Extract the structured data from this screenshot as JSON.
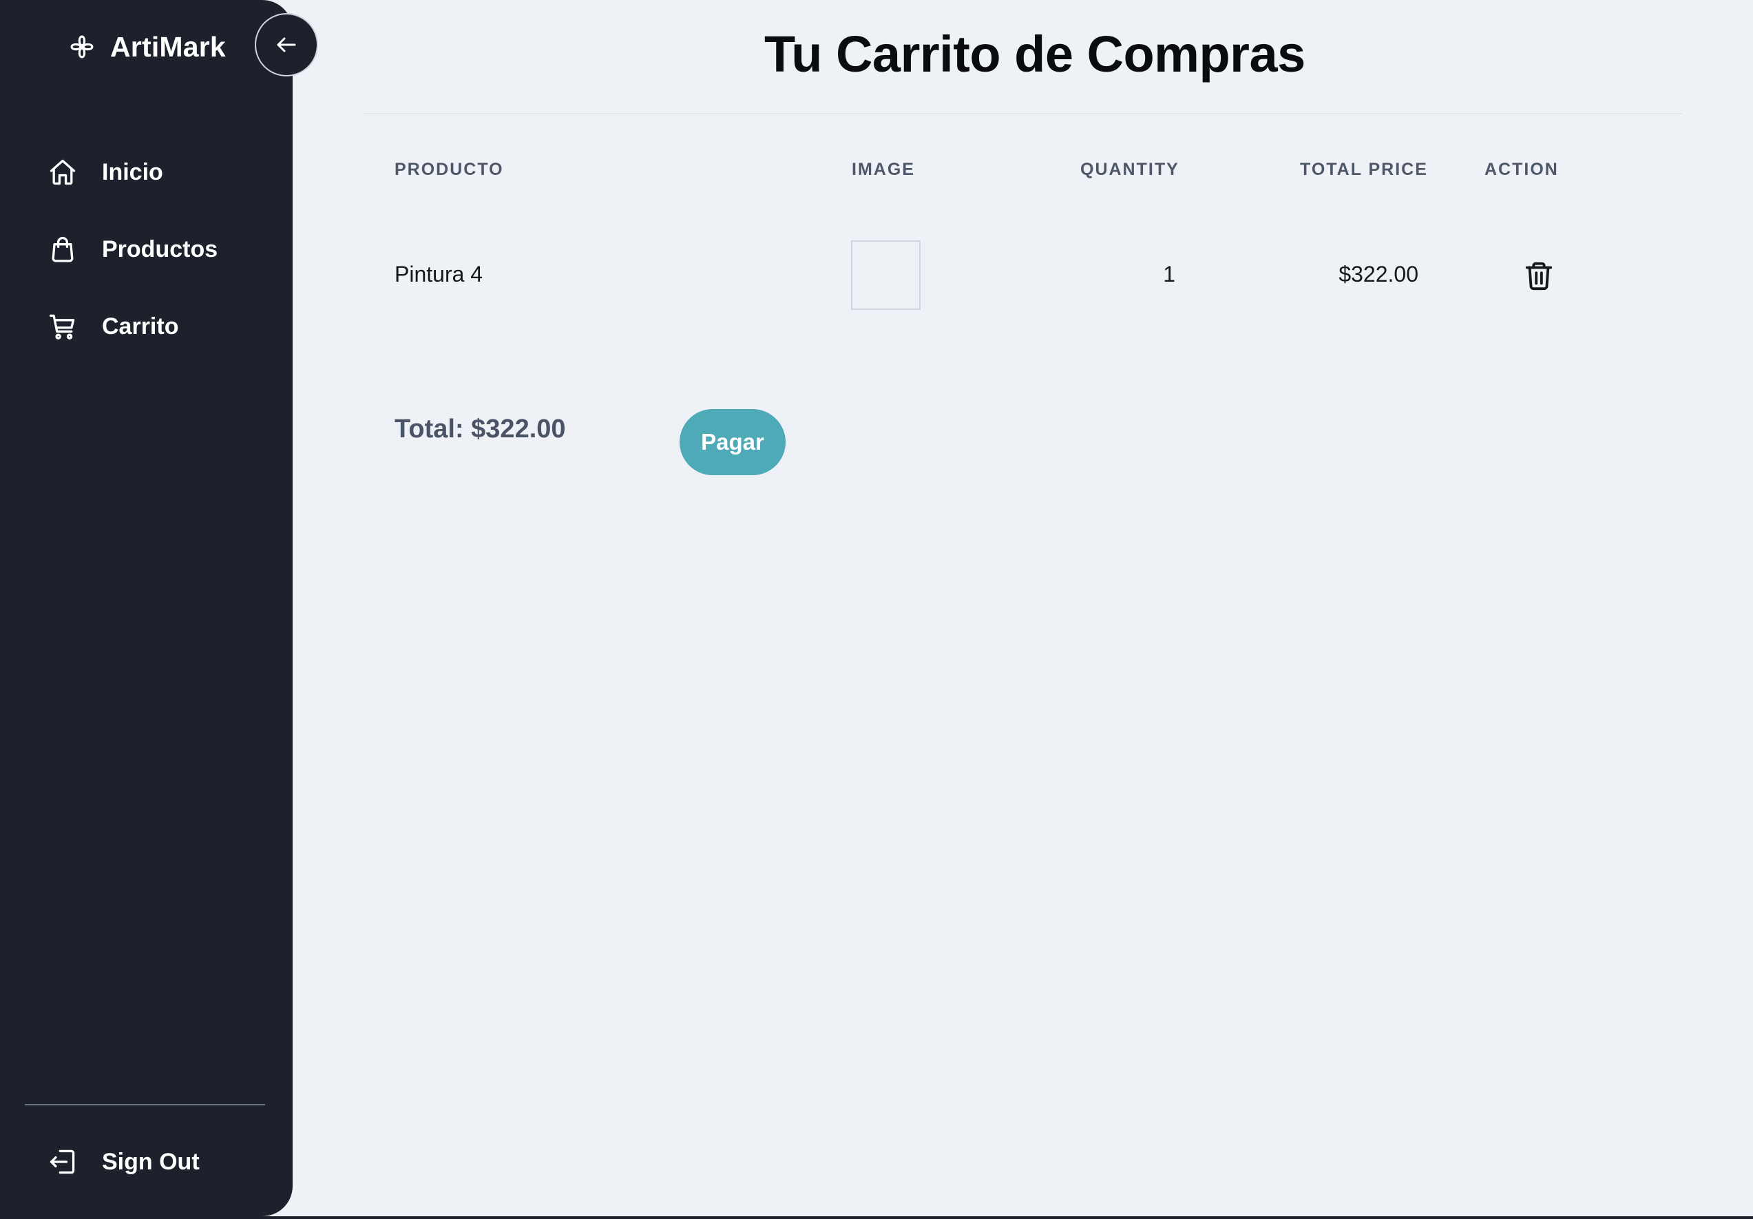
{
  "sidebar": {
    "brand": "ArtiMark",
    "nav_items": [
      {
        "label": "Inicio",
        "icon": "home-icon"
      },
      {
        "label": "Productos",
        "icon": "shopping-bag-icon"
      },
      {
        "label": "Carrito",
        "icon": "cart-icon"
      }
    ],
    "sign_out": {
      "label": "Sign Out",
      "icon": "sign-out-icon"
    },
    "collapse_icon": "arrow-left-icon"
  },
  "main": {
    "title": "Tu Carrito de Compras",
    "table": {
      "headers": [
        "PRODUCTO",
        "IMAGE",
        "QUANTITY",
        "TOTAL PRICE",
        "ACTION"
      ],
      "rows": [
        {
          "product": "Pintura 4",
          "quantity": "1",
          "total_price": "$322.00",
          "action_icon": "trash-icon"
        }
      ]
    },
    "total": "Total: $322.00",
    "pay_button": "Pagar"
  },
  "colors": {
    "sidebar_bg": "#1d212c",
    "main_bg": "#eef2f7",
    "accent": "#4eaab7",
    "title_text": "#0b0c0f"
  }
}
